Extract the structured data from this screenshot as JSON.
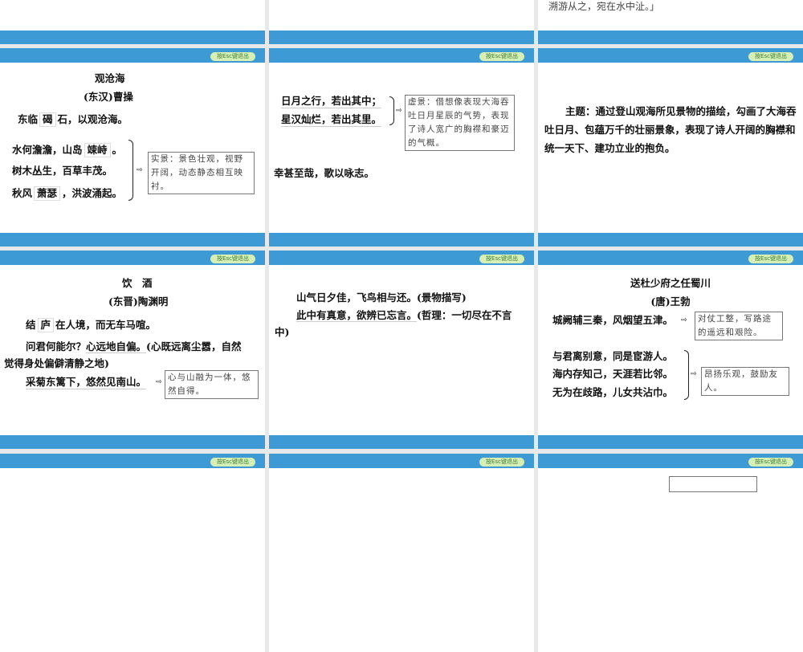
{
  "esc_label": "按Esc键退出",
  "colors": {
    "bar": "#3d9ad4",
    "esc_bg": "#d6efb4",
    "gap": "#e6e8ea"
  },
  "row1": {
    "right_text": "溯游从之，宛在水中沚。」"
  },
  "s_guancanghai": {
    "title": "观沧海",
    "author": "(东汉)曹操",
    "l1a": "东临",
    "l1b": "碣",
    "l1c": "石，以观沧海。",
    "l2a": "水何澹澹，山岛",
    "l2b": "竦峙",
    "l2c": "。",
    "l3": "树木丛生，百草丰茂。",
    "l4a": "秋风",
    "l4b": "萧瑟",
    "l4c": "，洪波涌起。",
    "note": "实景：景色壮观，视野开阔，动态静态相互映衬。"
  },
  "s_riyue": {
    "l1": "日月之行，若出其中；",
    "l2": "星汉灿烂，若出其里。",
    "note": "虚景：借想像表现大海吞吐日月星辰的气势，表现了诗人宽广的胸襟和豪迈的气概。",
    "l3": "幸甚至哉，歌以咏志。"
  },
  "s_theme": {
    "text": "主题：通过登山观海所见景物的描绘，勾画了大海吞吐日月、包蕴万千的壮丽景象，表现了诗人开阔的胸襟和统一天下、建功立业的抱负。"
  },
  "s_yinjiu": {
    "title": "饮　酒",
    "author": "(东晋)陶渊明",
    "l1a": "结",
    "l1b": "庐",
    "l1c": "在人境，而无车马喧。",
    "l2a": "问君何能尔？",
    "l2b": "心远地自偏。",
    "l2c": "(心既远离尘嚣，自然",
    "l3": "觉得身处偏僻清静之地)",
    "l4": "采菊东篱下，悠然见南山。",
    "note": "心与山融为一体，悠然自得。"
  },
  "s_shanqi": {
    "l1": "山气日夕佳，飞鸟相与还。(景物描写)",
    "l2a": "此中有真意，欲辨已忘言。",
    "l2b": "(哲理：一切尽在不言",
    "l3": "中)"
  },
  "s_songdu": {
    "title": "送杜少府之任蜀川",
    "author": "(唐)王勃",
    "l1": "城阙辅三秦，风烟望五津。",
    "note1": "对仗工整，写路途的遥远和艰险。",
    "l2": "与君离别意，同是宦游人。",
    "l3": "海内存知己，天涯若比邻。",
    "l4": "无为在歧路，儿女共沾巾。",
    "note2": "昂扬乐观，鼓励友人。"
  }
}
